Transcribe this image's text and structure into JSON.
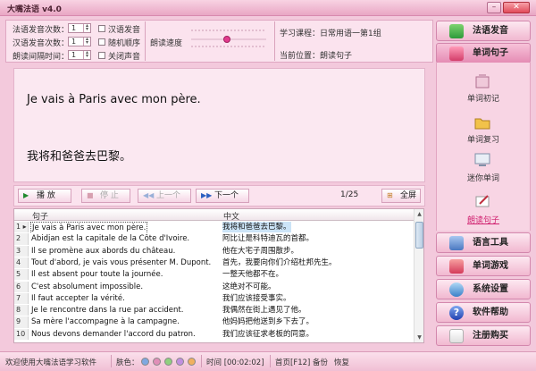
{
  "window": {
    "title": "大嘴法语 v4.0"
  },
  "settings": {
    "fr_repeat_label": "法语发音次数：",
    "fr_repeat_value": "1",
    "zh_repeat_label": "汉语发音次数：",
    "zh_repeat_value": "1",
    "interval_label": "朗读间隔时间：",
    "interval_value": "1",
    "check_zh": "汉语发音",
    "check_random": "随机顺序",
    "check_mute": "关闭声音",
    "speed_label": "朗读速度"
  },
  "course": {
    "course_label": "学习课程：日常用语一第1组",
    "position_label": "当前位置：朗读句子"
  },
  "display": {
    "sentence_fr": "Je vais à Paris avec mon père.",
    "sentence_zh": "我将和爸爸去巴黎。"
  },
  "controls": {
    "play": "播 放",
    "stop": "停 止",
    "prev": "上一个",
    "next": "下一个",
    "counter": "1/25",
    "fullscreen": "全屏"
  },
  "list": {
    "col_sentence": "句子",
    "col_chinese": "中文",
    "rows": [
      {
        "num": "1",
        "fr": "Je vais à Paris avec mon père.",
        "zh": "我将和爸爸去巴黎。"
      },
      {
        "num": "2",
        "fr": "Abidjan est la capitale de la Côte d'Ivoire.",
        "zh": "阿比让是科特迪瓦的首都。"
      },
      {
        "num": "3",
        "fr": "Il se promène aux abords du château.",
        "zh": "他在大宅子周围散步。"
      },
      {
        "num": "4",
        "fr": "Tout d'abord, je vais vous présenter M. Dupont.",
        "zh": "首先，我要向你们介绍杜邦先生。"
      },
      {
        "num": "5",
        "fr": "Il est absent pour toute la journée.",
        "zh": "一整天他都不在。"
      },
      {
        "num": "6",
        "fr": "C'est absolument impossible.",
        "zh": "这绝对不可能。"
      },
      {
        "num": "7",
        "fr": "Il faut accepter la vérité.",
        "zh": "我们应该接受事实。"
      },
      {
        "num": "8",
        "fr": "Je le rencontre dans la rue par accident.",
        "zh": "我偶然在街上遇见了他。"
      },
      {
        "num": "9",
        "fr": "Sa mère l'accompagne à la campagne.",
        "zh": "他妈妈把他送到乡下去了。"
      },
      {
        "num": "10",
        "fr": "Nous devons demander l'accord du patron.",
        "zh": "我们应该征求老板的同意。"
      }
    ]
  },
  "sidebar": {
    "pronunciation": "法语发音",
    "word_sentence": "单词句子",
    "sub_items": [
      "单词初记",
      "单词复习",
      "迷你单词",
      "朗读句子"
    ],
    "language_tools": "语言工具",
    "word_game": "单词游戏",
    "settings": "系统设置",
    "help": "软件帮助",
    "register": "注册购买"
  },
  "status": {
    "welcome": "欢迎使用大嘴法语学习软件",
    "skin_label": "肤色：",
    "skin_colors": [
      "#7fa8e0",
      "#e08fb8",
      "#8fd07f",
      "#c08fe0",
      "#f0b060"
    ],
    "time": "时间 [00:02:02]",
    "home": "首页[F12]",
    "backup": "备份",
    "restore": "恢复"
  },
  "colors": {
    "accent": "#e23a8d",
    "panel": "#fbe3ee"
  }
}
